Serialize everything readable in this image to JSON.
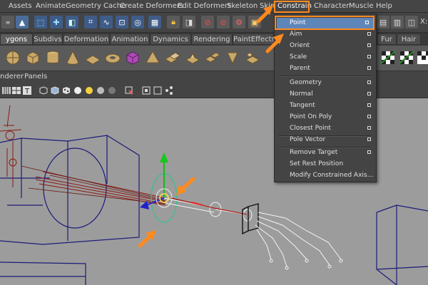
{
  "menubar": {
    "items": [
      "Assets",
      "Animate",
      "Geometry Cache",
      "Create Deformers",
      "Edit Deformers",
      "Skeleton",
      "Skin",
      "Constrain",
      "Character",
      "Muscle",
      "Help"
    ]
  },
  "toolbar": {
    "coord_label": "X:"
  },
  "shelf_tabs": [
    "ygons",
    "Subdivs",
    "Deformation",
    "Animation",
    "Dynamics",
    "Rendering",
    "PaintEffects",
    "Fur",
    "Hair"
  ],
  "active_shelf_tab": "ygons",
  "panel_menu": [
    "nderer",
    "Panels"
  ],
  "constrain_menu": {
    "highlighted": "Point",
    "groups": [
      [
        "Point",
        "Aim",
        "Orient",
        "Scale",
        "Parent"
      ],
      [
        "Geometry",
        "Normal",
        "Tangent",
        "Point On Poly",
        "Closest Point"
      ],
      [
        "Pole Vector"
      ],
      [
        "Remove Target",
        "Set Rest Position",
        "Modify Constrained Axis..."
      ]
    ],
    "items": [
      {
        "label": "Point",
        "option": true
      },
      {
        "label": "Aim",
        "option": true
      },
      {
        "label": "Orient",
        "option": true
      },
      {
        "label": "Scale",
        "option": true
      },
      {
        "label": "Parent",
        "option": true
      },
      {
        "label": "Geometry",
        "option": true
      },
      {
        "label": "Normal",
        "option": true
      },
      {
        "label": "Tangent",
        "option": true
      },
      {
        "label": "Point On Poly",
        "option": true
      },
      {
        "label": "Closest Point",
        "option": true
      },
      {
        "label": "Pole Vector",
        "option": true
      },
      {
        "label": "Remove Target",
        "option": true
      },
      {
        "label": "Set Rest Position",
        "option": false
      },
      {
        "label": "Modify Constrained Axis...",
        "option": false
      }
    ]
  },
  "colors": {
    "highlight": "#ff8a1f",
    "menu_selected": "#5f86b8",
    "viewport_bg": "#9c9c9c"
  }
}
